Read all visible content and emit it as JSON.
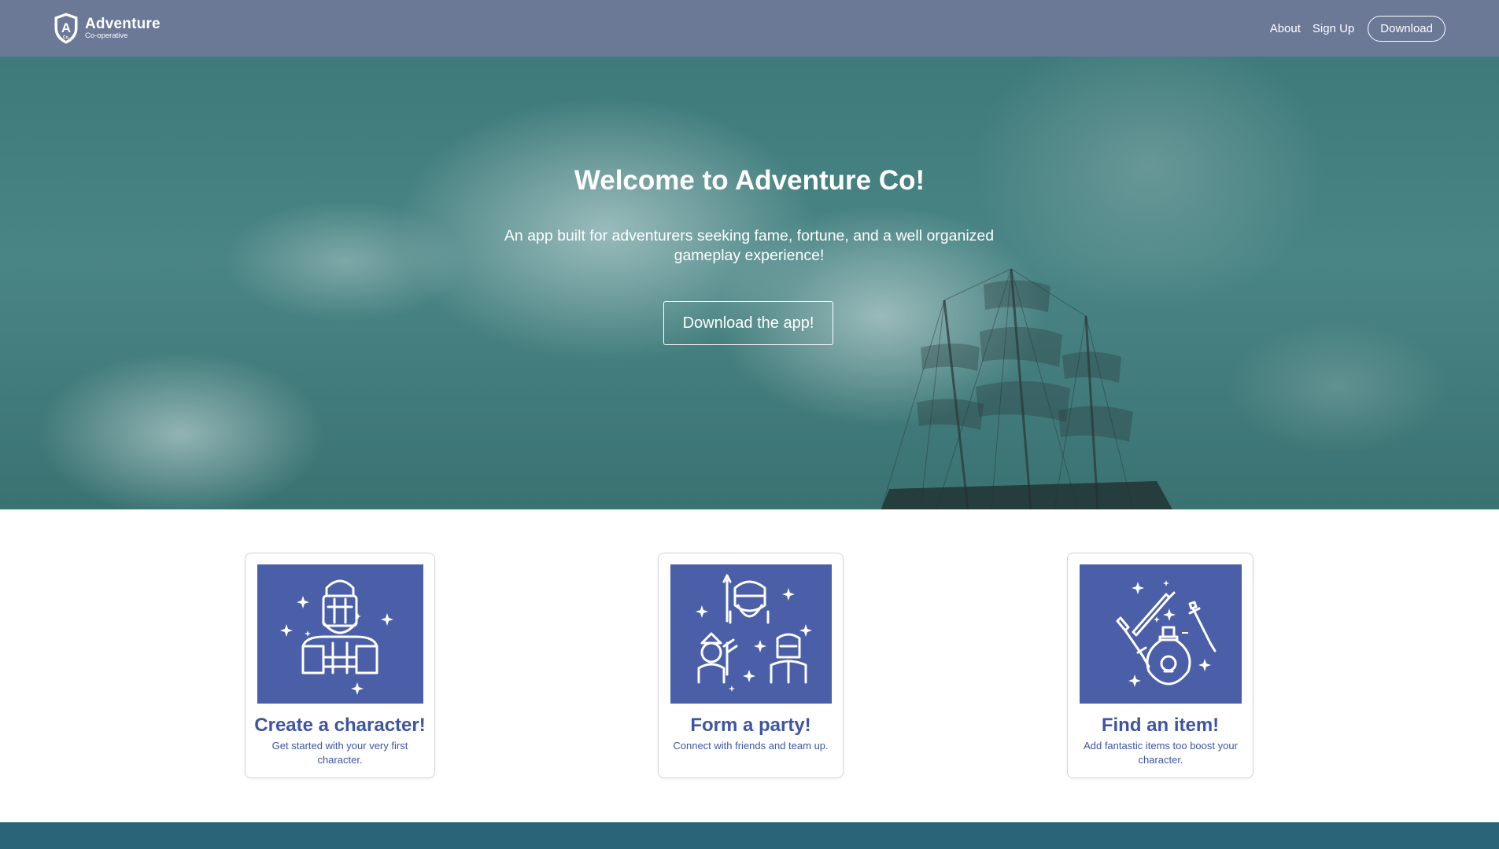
{
  "navbar": {
    "brand_name": "Adventure",
    "brand_sub": "Co-operative",
    "logo_letter": "A",
    "logo_sub": "Co.",
    "links": [
      {
        "label": "About"
      },
      {
        "label": "Sign Up"
      }
    ],
    "download_label": "Download"
  },
  "hero": {
    "title": "Welcome to Adventure Co!",
    "subtitle": "An app built for adventurers seeking fame, fortune, and a well organized gameplay experience!",
    "button_label": "Download the app!"
  },
  "features": [
    {
      "title": "Create a character!",
      "description": "Get started with your very first character.",
      "icon": "knight-icon"
    },
    {
      "title": "Form a party!",
      "description": "Connect with friends and team up.",
      "icon": "party-icon"
    },
    {
      "title": "Find an item!",
      "description": "Add fantastic items too boost your character.",
      "icon": "items-icon"
    }
  ],
  "colors": {
    "navbar": "#6b7896",
    "hero_teal": "#4a8585",
    "card_image_bg": "#4a5fa8",
    "card_text": "#3d55a6",
    "footer": "#2a6479"
  }
}
